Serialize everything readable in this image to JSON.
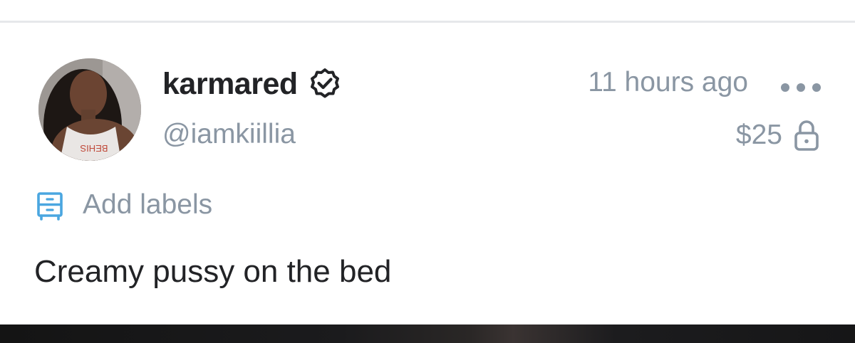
{
  "post": {
    "author": {
      "display_name": "karmared",
      "handle": "@iamkiillia",
      "verified": true
    },
    "timestamp": "11 hours ago",
    "price": "$25",
    "labels_action": "Add labels",
    "text": "Creamy pussy on the bed"
  },
  "icons": {
    "verified": "verified-badge-icon",
    "more": "more-options-icon",
    "lock": "lock-icon",
    "labels": "labels-icon"
  },
  "colors": {
    "text_primary": "#222326",
    "text_secondary": "#8a96a3",
    "accent": "#4aa6e0",
    "divider": "#e6e8eb"
  }
}
